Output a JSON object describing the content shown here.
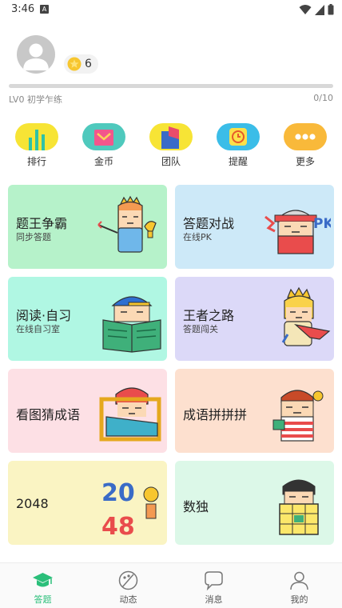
{
  "status_bar": {
    "time": "3:46",
    "notification_glyph": "A"
  },
  "profile": {
    "coins": "6",
    "level_label": "LV0 初学乍练",
    "level_progress_text": "0/10",
    "level_progress_fraction": 0
  },
  "quick_actions": [
    {
      "label": "排行",
      "icon": "ranking-icon",
      "color": "#f7e435"
    },
    {
      "label": "金币",
      "icon": "wallet-icon",
      "color": "#4fc9bd"
    },
    {
      "label": "团队",
      "icon": "team-flag-icon",
      "color": "#f7e435"
    },
    {
      "label": "提醒",
      "icon": "alarm-clock-icon",
      "color": "#3bbde8"
    },
    {
      "label": "更多",
      "icon": "more-icon",
      "color": "#f9b93a"
    }
  ],
  "cards": [
    {
      "title": "题王争霸",
      "subtitle": "同步答题",
      "color": "#b6f2ca"
    },
    {
      "title": "答题对战",
      "subtitle": "在线PK",
      "color": "#cde9f8"
    },
    {
      "title": "阅读·自习",
      "subtitle": "在线自习室",
      "color": "#b0f7e3"
    },
    {
      "title": "王者之路",
      "subtitle": "答题闯关",
      "color": "#dcd9f8"
    },
    {
      "title": "看图猜成语",
      "subtitle": "",
      "color": "#fde0e5"
    },
    {
      "title": "成语拼拼拼",
      "subtitle": "",
      "color": "#fde0cf"
    },
    {
      "title": "2048",
      "subtitle": "",
      "color": "#faf4c3"
    },
    {
      "title": "数独",
      "subtitle": "",
      "color": "#dcf8e8"
    }
  ],
  "art_text": {
    "pk": "PK",
    "n2048_a": "20",
    "n2048_b": "48"
  },
  "bottom_nav": [
    {
      "label": "答题",
      "icon": "graduation-cap-icon",
      "active": true
    },
    {
      "label": "动态",
      "icon": "palette-icon",
      "active": false
    },
    {
      "label": "消息",
      "icon": "chat-bubble-icon",
      "active": false
    },
    {
      "label": "我的",
      "icon": "user-icon",
      "active": false
    }
  ],
  "colors": {
    "accent": "#2bbf7a",
    "level_fill": "#9ccf3a"
  }
}
